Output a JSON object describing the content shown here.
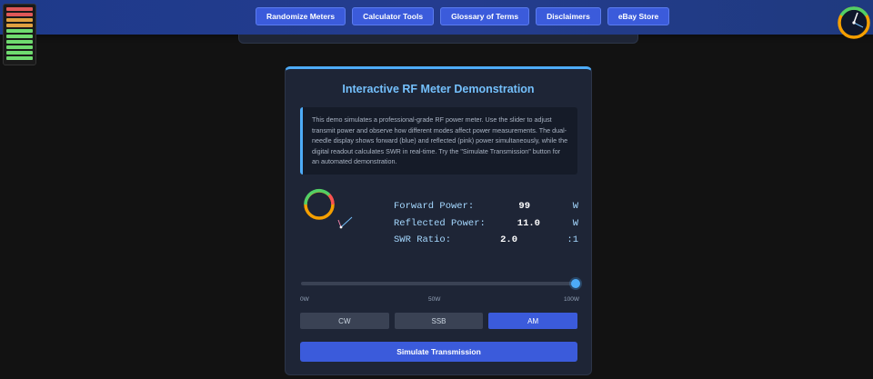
{
  "nav": {
    "buttons": [
      {
        "label": "Randomize Meters"
      },
      {
        "label": "Calculator Tools"
      },
      {
        "label": "Glossary of Terms"
      },
      {
        "label": "Disclaimers"
      },
      {
        "label": "eBay Store"
      }
    ]
  },
  "led_meter": {
    "levels": [
      "#e05858",
      "#e05858",
      "#e0a040",
      "#e0a040",
      "#6fdb6f",
      "#6fdb6f",
      "#6fdb6f",
      "#6fdb6f",
      "#6fdb6f",
      "#6fdb6f"
    ]
  },
  "panel": {
    "title": "Interactive RF Meter Demonstration",
    "info": "This demo simulates a professional-grade RF power meter. Use the slider to adjust transmit power and observe how different modes affect power measurements. The dual-needle display shows forward (blue) and reflected (pink) power simultaneously, while the digital readout calculates SWR in real-time. Try the \"Simulate Transmission\" button for an automated demonstration.",
    "readout": {
      "forward": {
        "label": "Forward Power:",
        "value": "99",
        "unit": "W"
      },
      "reflected": {
        "label": "Reflected Power:",
        "value": "11.0",
        "unit": "W"
      },
      "swr": {
        "label": "SWR Ratio:",
        "value": "2.0",
        "unit": ":1"
      }
    },
    "slider": {
      "value_fraction": 0.99
    },
    "ticks": {
      "min": "0W",
      "mid": "50W",
      "max": "100W"
    },
    "modes": [
      {
        "label": "CW",
        "active": false
      },
      {
        "label": "SSB",
        "active": false
      },
      {
        "label": "AM",
        "active": true
      }
    ],
    "simulate_label": "Simulate Transmission"
  },
  "colors": {
    "accent": "#3b5bdb",
    "title": "#74c0fc",
    "forward_needle": "#74c0fc",
    "reflected_needle": "#f783ac"
  }
}
